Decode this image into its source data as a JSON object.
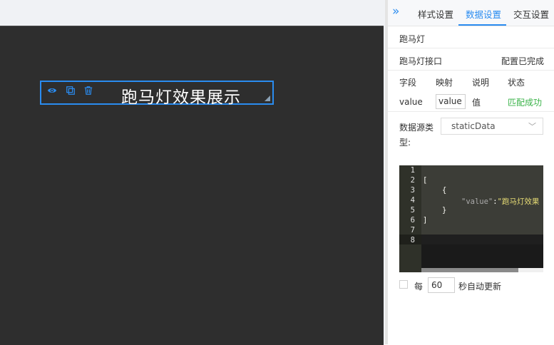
{
  "canvas": {
    "widget_title": "跑马灯效果展示",
    "icons": [
      "eye-icon",
      "copy-icon",
      "trash-icon",
      "resize-handle-icon"
    ]
  },
  "panel": {
    "collapse_glyph": "»",
    "tabs": [
      {
        "label": "样式设置",
        "active": false
      },
      {
        "label": "数据设置",
        "active": true
      },
      {
        "label": "交互设置",
        "active": false
      }
    ],
    "component_name": "跑马灯",
    "interface_label": "跑马灯接口",
    "interface_status": "配置已完成",
    "mapping": {
      "headers": [
        "字段",
        "映射",
        "说明",
        "状态"
      ],
      "row": {
        "field": "value",
        "mapping": "value",
        "desc": "值",
        "status": "匹配成功"
      }
    },
    "data_source": {
      "label_line1": "数据源类",
      "label_line2": "型:",
      "value": "staticData"
    },
    "editor": {
      "line_numbers": [
        "1",
        "2",
        "3",
        "4",
        "5",
        "6",
        "7",
        "8"
      ],
      "lines": {
        "l2": "[",
        "l3": "{",
        "l4_key": "\"value\"",
        "l4_colon": ":",
        "l4_val": "\"跑马灯效果",
        "l5": "}",
        "l6": "]"
      }
    },
    "auto_update": {
      "prefix": "每",
      "seconds": "60",
      "suffix": "秒自动更新"
    }
  },
  "colors": {
    "accent": "#2a8cf0",
    "success": "#3bb34a",
    "canvas_bg": "#2e2e2e"
  }
}
